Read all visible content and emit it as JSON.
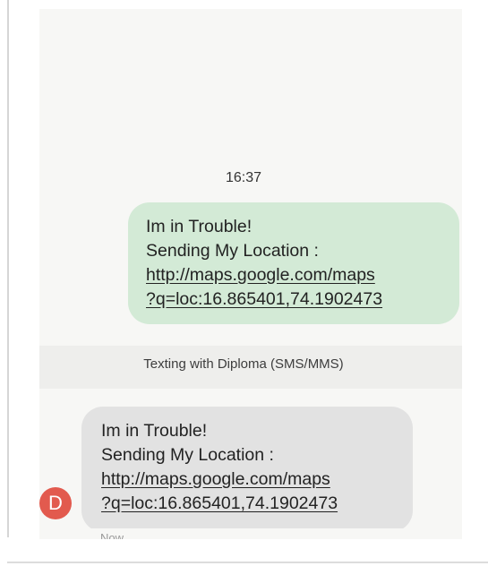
{
  "conversation": {
    "timestamp": "16:37",
    "sent_message": {
      "line1": "Im in Trouble!",
      "line2": "Sending My Location :",
      "link_line1": "http://maps.google.com/maps",
      "link_line2": "?q=loc:16.865401,74.1902473"
    },
    "divider_label": "Texting with Diploma (SMS/MMS)",
    "received_message": {
      "avatar_letter": "D",
      "line1": "Im in Trouble!",
      "line2": "Sending My Location :",
      "link_line1": "http://maps.google.com/maps",
      "link_line2": "?q=loc:16.865401,74.1902473",
      "status": "Now"
    }
  },
  "colors": {
    "sent_bubble": "#d3ead6",
    "received_bubble": "#e2e2e2",
    "avatar": "#e25a4e"
  }
}
